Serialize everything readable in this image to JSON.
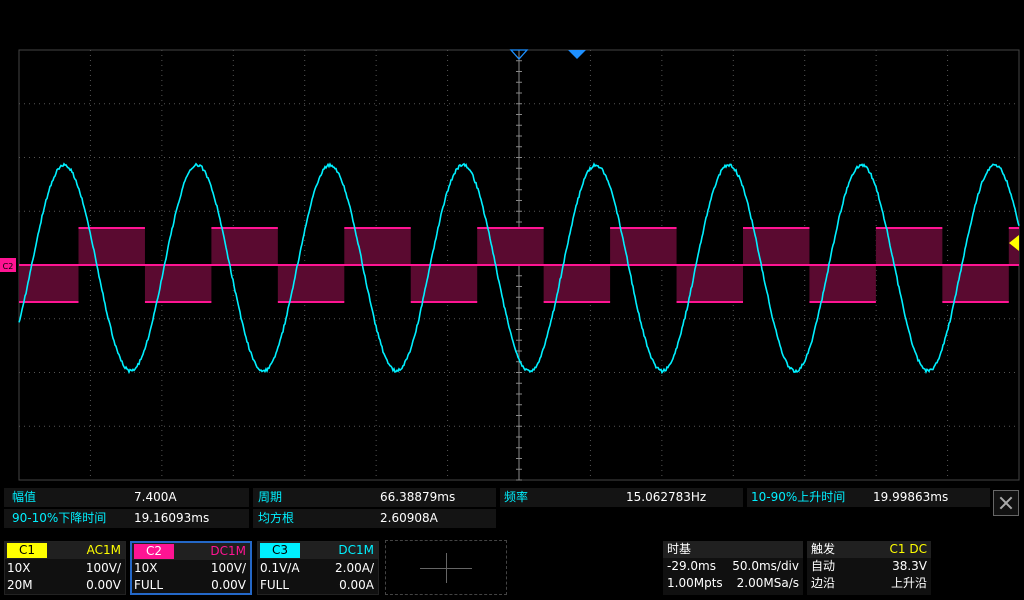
{
  "colors": {
    "c1": "#ffff00",
    "c2": "#ff1493",
    "c3": "#00f0ff",
    "fill": "#5a0a30",
    "grid": "#555555",
    "trigger": "#1e90ff"
  },
  "channel_marker": "C2",
  "measurements": {
    "amplitude_label": "幅值",
    "amplitude_value": "7.400A",
    "period_label": "周期",
    "period_value": "66.38879ms",
    "freq_label": "频率",
    "freq_value": "15.062783Hz",
    "rise_label": "10-90%上升时间",
    "rise_value": "19.99863ms",
    "fall_label": "90-10%下降时间",
    "fall_value": "19.16093ms",
    "rms_label": "均方根",
    "rms_value": "2.60908A"
  },
  "channels": {
    "c1": {
      "name": "C1",
      "coupling": "AC1M",
      "probe": "10X",
      "scale": "100V/",
      "bw": "20M",
      "offset": "0.00V"
    },
    "c2": {
      "name": "C2",
      "coupling": "DC1M",
      "probe": "10X",
      "scale": "100V/",
      "bw": "FULL",
      "offset": "0.00V"
    },
    "c3": {
      "name": "C3",
      "coupling": "DC1M",
      "probe": "0.1V/A",
      "scale": "2.00A/",
      "bw": "FULL",
      "offset": "0.00A"
    }
  },
  "timebase": {
    "title": "时基",
    "delay": "-29.0ms",
    "scale": "50.0ms/div",
    "memory": "1.00Mpts",
    "rate": "2.00MSa/s"
  },
  "trigger": {
    "title": "触发",
    "source": "C1 DC",
    "mode": "自动",
    "level": "38.3V",
    "type": "边沿",
    "slope": "上升沿"
  }
}
